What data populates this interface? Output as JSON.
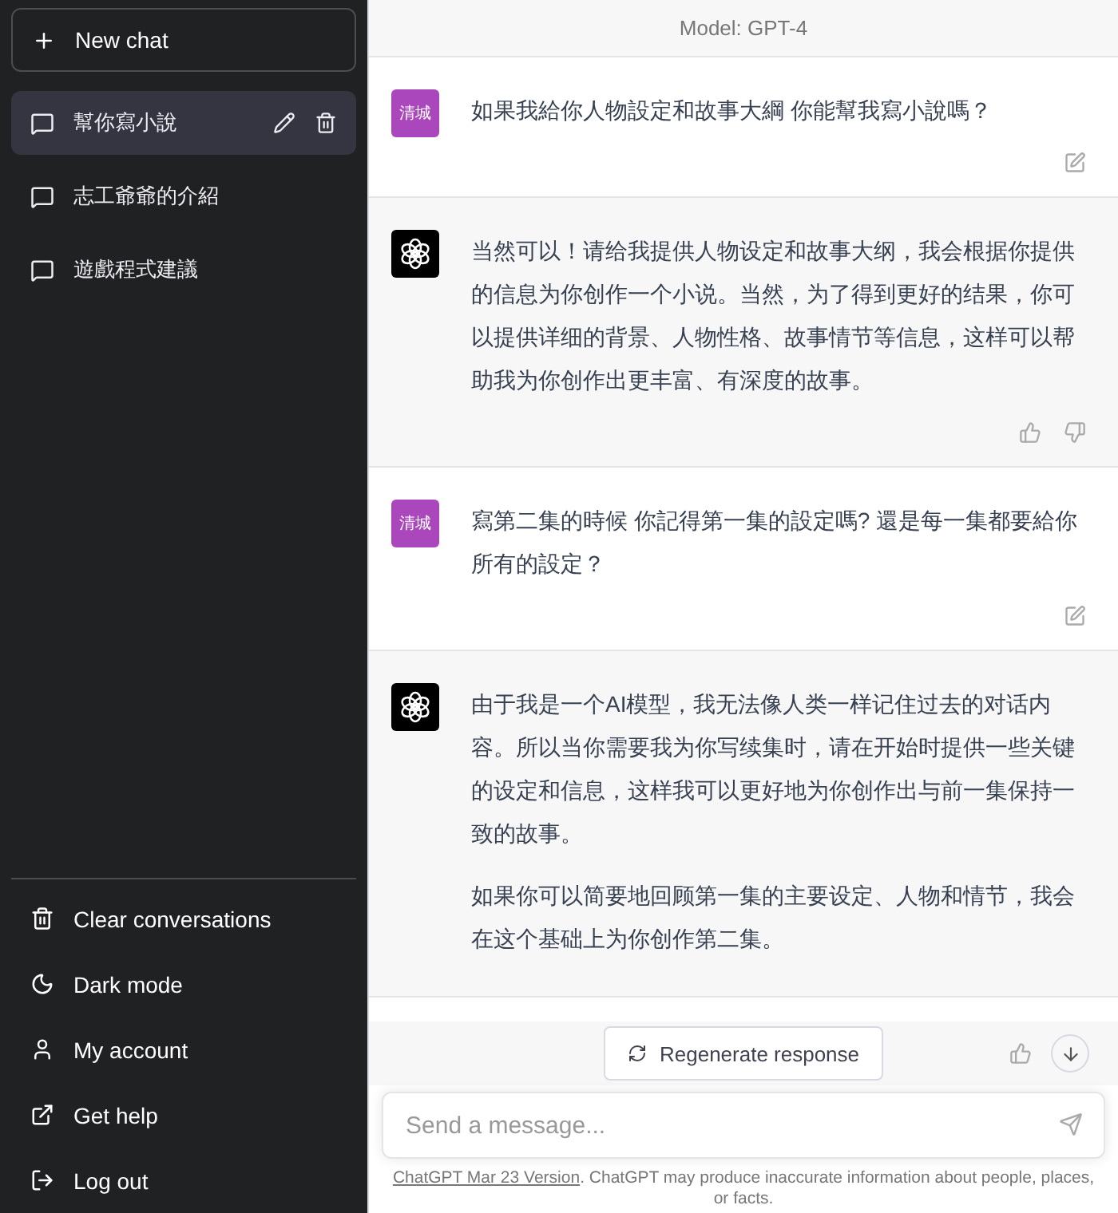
{
  "sidebar": {
    "new_chat": "New chat",
    "conversations": [
      {
        "title": "幫你寫小說",
        "selected": true
      },
      {
        "title": "志工爺爺的介紹",
        "selected": false
      },
      {
        "title": "遊戲程式建議",
        "selected": false
      }
    ],
    "menu": [
      {
        "label": "Clear conversations",
        "kind": "trash"
      },
      {
        "label": "Dark mode",
        "kind": "moon"
      },
      {
        "label": "My account",
        "kind": "user"
      },
      {
        "label": "Get help",
        "kind": "external"
      },
      {
        "label": "Log out",
        "kind": "logout"
      }
    ]
  },
  "header": {
    "model": "Model: GPT-4"
  },
  "messages": [
    {
      "kind": "user",
      "avatar": "清城",
      "paragraphs": [
        "如果我給你人物設定和故事大綱 你能幫我寫小說嗎？"
      ],
      "actions": [
        {
          "kind": "edit"
        }
      ]
    },
    {
      "kind": "assistant",
      "paragraphs": [
        "当然可以！请给我提供人物设定和故事大纲，我会根据你提供的信息为你创作一个小说。当然，为了得到更好的结果，你可以提供详细的背景、人物性格、故事情节等信息，这样可以帮助我为你创作出更丰富、有深度的故事。"
      ],
      "actions": [
        {
          "kind": "thumbs_up"
        },
        {
          "kind": "thumbs_down"
        }
      ]
    },
    {
      "kind": "user",
      "avatar": "清城",
      "paragraphs": [
        "寫第二集的時候 你記得第一集的設定嗎? 還是每一集都要給你所有的設定？"
      ],
      "actions": [
        {
          "kind": "edit"
        }
      ]
    },
    {
      "kind": "assistant",
      "paragraphs": [
        "由于我是一个AI模型，我无法像人类一样记住过去的对话内容。所以当你需要我为你写续集时，请在开始时提供一些关键的设定和信息，这样我可以更好地为你创作出与前一集保持一致的故事。",
        "如果你可以简要地回顾第一集的主要设定、人物和情节，我会在这个基础上为你创作第二集。"
      ],
      "actions": [
        {
          "kind": "thumbs_up"
        }
      ]
    }
  ],
  "regenerate": "Regenerate response",
  "composer": {
    "placeholder": "Send a message..."
  },
  "footer": {
    "link": "ChatGPT Mar 23 Version",
    "text": ". ChatGPT may produce inaccurate information about people, places, or facts."
  }
}
